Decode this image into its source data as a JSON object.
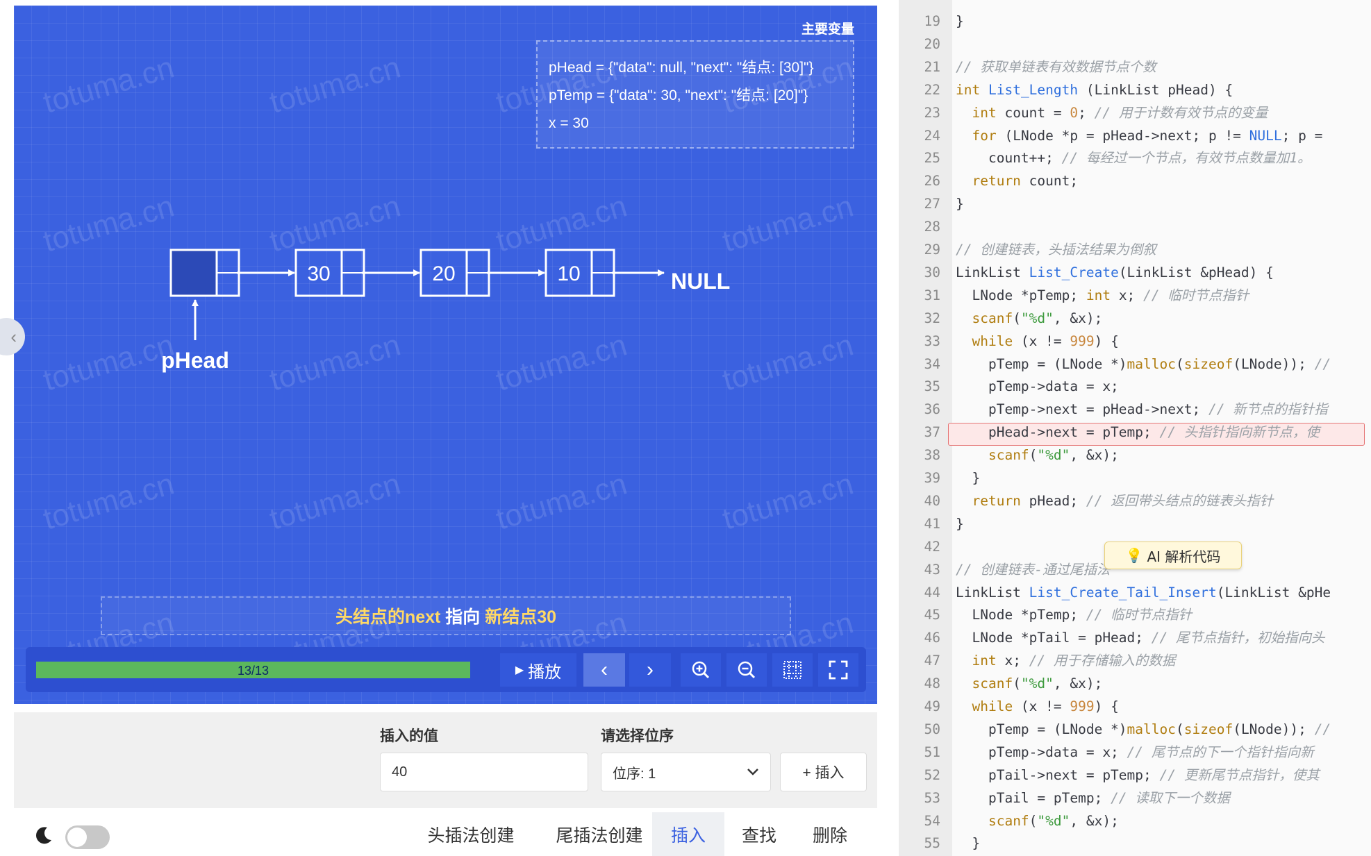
{
  "visual": {
    "vars_title": "主要变量",
    "vars": [
      "pHead = {\"data\": null, \"next\": \"结点: [30]\"}",
      "pTemp = {\"data\": 30, \"next\": \"结点: [20]\"}",
      "x = 30"
    ],
    "watermark": "totuma.cn",
    "nodes": [
      "",
      "30",
      "20",
      "10"
    ],
    "null_label": "NULL",
    "head_label": "pHead",
    "caption": {
      "part1": "头结点的next",
      "part2": " 指向 ",
      "part3": "新结点30"
    }
  },
  "controls": {
    "progress_text": "13/13",
    "progress": 1.0,
    "play_label": "播放",
    "prev_glyph": "‹",
    "next_glyph": "›"
  },
  "form": {
    "value_label": "插入的值",
    "value": "40",
    "position_label": "请选择位序",
    "position_value": "位序: 1",
    "insert_label": "+ 插入"
  },
  "tabs": [
    {
      "label": "头插法创建",
      "active": false
    },
    {
      "label": "尾插法创建",
      "active": false
    },
    {
      "label": "插入",
      "active": true
    },
    {
      "label": "查找",
      "active": false
    },
    {
      "label": "删除",
      "active": false
    }
  ],
  "ai_button": "AI 解析代码",
  "code": {
    "highlight_line": 37,
    "lines": [
      {
        "n": "19",
        "t": [
          [
            "p",
            "}"
          ]
        ]
      },
      {
        "n": "20",
        "t": []
      },
      {
        "n": "21",
        "t": [
          [
            "cm",
            "// 获取单链表有效数据节点个数"
          ]
        ]
      },
      {
        "n": "22",
        "t": [
          [
            "kw",
            "int"
          ],
          [
            "p",
            " "
          ],
          [
            "fn",
            "List_Length"
          ],
          [
            "p",
            " (LinkList pHead) {"
          ]
        ]
      },
      {
        "n": "23",
        "t": [
          [
            "p",
            "  "
          ],
          [
            "kw",
            "int"
          ],
          [
            "p",
            " count = "
          ],
          [
            "num",
            "0"
          ],
          [
            "p",
            "; "
          ],
          [
            "cm",
            "// 用于计数有效节点的变量"
          ]
        ]
      },
      {
        "n": "24",
        "t": [
          [
            "p",
            "  "
          ],
          [
            "kw",
            "for"
          ],
          [
            "p",
            " (LNode *p = pHead->next; p != "
          ],
          [
            "nul",
            "NULL"
          ],
          [
            "p",
            "; p ="
          ]
        ]
      },
      {
        "n": "25",
        "t": [
          [
            "p",
            "    count++; "
          ],
          [
            "cm",
            "// 每经过一个节点，有效节点数量加1。"
          ]
        ]
      },
      {
        "n": "26",
        "t": [
          [
            "p",
            "  "
          ],
          [
            "kw",
            "return"
          ],
          [
            "p",
            " count;"
          ]
        ]
      },
      {
        "n": "27",
        "t": [
          [
            "p",
            "}"
          ]
        ]
      },
      {
        "n": "28",
        "t": []
      },
      {
        "n": "29",
        "t": [
          [
            "cm",
            "// 创建链表，头插法结果为倒叙"
          ]
        ]
      },
      {
        "n": "30",
        "t": [
          [
            "p",
            "LinkList "
          ],
          [
            "fn",
            "List_Create"
          ],
          [
            "p",
            "(LinkList &pHead) {"
          ]
        ]
      },
      {
        "n": "31",
        "t": [
          [
            "p",
            "  LNode *pTemp; "
          ],
          [
            "kw",
            "int"
          ],
          [
            "p",
            " x; "
          ],
          [
            "cm",
            "// 临时节点指针"
          ]
        ]
      },
      {
        "n": "32",
        "t": [
          [
            "p",
            "  "
          ],
          [
            "kw",
            "scanf"
          ],
          [
            "p",
            "("
          ],
          [
            "str",
            "\"%d\""
          ],
          [
            "p",
            ", &x);"
          ]
        ]
      },
      {
        "n": "33",
        "t": [
          [
            "p",
            "  "
          ],
          [
            "kw",
            "while"
          ],
          [
            "p",
            " (x != "
          ],
          [
            "num",
            "999"
          ],
          [
            "p",
            ") {"
          ]
        ]
      },
      {
        "n": "34",
        "t": [
          [
            "p",
            "    pTemp = (LNode *)"
          ],
          [
            "kw",
            "malloc"
          ],
          [
            "p",
            "("
          ],
          [
            "kw",
            "sizeof"
          ],
          [
            "p",
            "(LNode)); "
          ],
          [
            "cm",
            "//"
          ]
        ]
      },
      {
        "n": "35",
        "t": [
          [
            "p",
            "    pTemp->data = x;"
          ]
        ]
      },
      {
        "n": "36",
        "t": [
          [
            "p",
            "    pTemp->next = pHead->next; "
          ],
          [
            "cm",
            "// 新节点的指针指"
          ]
        ]
      },
      {
        "n": "37",
        "t": [
          [
            "p",
            "    pHead->next = pTemp; "
          ],
          [
            "cm",
            "// 头指针指向新节点，使"
          ]
        ]
      },
      {
        "n": "38",
        "t": [
          [
            "p",
            "    "
          ],
          [
            "kw",
            "scanf"
          ],
          [
            "p",
            "("
          ],
          [
            "str",
            "\"%d\""
          ],
          [
            "p",
            ", &x);"
          ]
        ]
      },
      {
        "n": "39",
        "t": [
          [
            "p",
            "  }"
          ]
        ]
      },
      {
        "n": "40",
        "t": [
          [
            "p",
            "  "
          ],
          [
            "kw",
            "return"
          ],
          [
            "p",
            " pHead; "
          ],
          [
            "cm",
            "// 返回带头结点的链表头指针"
          ]
        ]
      },
      {
        "n": "41",
        "t": [
          [
            "p",
            "}"
          ]
        ]
      },
      {
        "n": "42",
        "t": []
      },
      {
        "n": "43",
        "t": [
          [
            "cm",
            "// 创建链表-通过尾插法"
          ]
        ]
      },
      {
        "n": "44",
        "t": [
          [
            "p",
            "LinkList "
          ],
          [
            "fn",
            "List_Create_Tail_Insert"
          ],
          [
            "p",
            "(LinkList &pHe"
          ]
        ]
      },
      {
        "n": "45",
        "t": [
          [
            "p",
            "  LNode *pTemp; "
          ],
          [
            "cm",
            "// 临时节点指针"
          ]
        ]
      },
      {
        "n": "46",
        "t": [
          [
            "p",
            "  LNode *pTail = pHead; "
          ],
          [
            "cm",
            "// 尾节点指针，初始指向头"
          ]
        ]
      },
      {
        "n": "47",
        "t": [
          [
            "p",
            "  "
          ],
          [
            "kw",
            "int"
          ],
          [
            "p",
            " x; "
          ],
          [
            "cm",
            "// 用于存储输入的数据"
          ]
        ]
      },
      {
        "n": "48",
        "t": [
          [
            "p",
            "  "
          ],
          [
            "kw",
            "scanf"
          ],
          [
            "p",
            "("
          ],
          [
            "str",
            "\"%d\""
          ],
          [
            "p",
            ", &x);"
          ]
        ]
      },
      {
        "n": "49",
        "t": [
          [
            "p",
            "  "
          ],
          [
            "kw",
            "while"
          ],
          [
            "p",
            " (x != "
          ],
          [
            "num",
            "999"
          ],
          [
            "p",
            ") {"
          ]
        ]
      },
      {
        "n": "50",
        "t": [
          [
            "p",
            "    pTemp = (LNode *)"
          ],
          [
            "kw",
            "malloc"
          ],
          [
            "p",
            "("
          ],
          [
            "kw",
            "sizeof"
          ],
          [
            "p",
            "(LNode)); "
          ],
          [
            "cm",
            "//"
          ]
        ]
      },
      {
        "n": "51",
        "t": [
          [
            "p",
            "    pTemp->data = x; "
          ],
          [
            "cm",
            "// 尾节点的下一个指针指向新"
          ]
        ]
      },
      {
        "n": "52",
        "t": [
          [
            "p",
            "    pTail->next = pTemp; "
          ],
          [
            "cm",
            "// 更新尾节点指针，使其"
          ]
        ]
      },
      {
        "n": "53",
        "t": [
          [
            "p",
            "    pTail = pTemp; "
          ],
          [
            "cm",
            "// 读取下一个数据"
          ]
        ]
      },
      {
        "n": "54",
        "t": [
          [
            "p",
            "    "
          ],
          [
            "kw",
            "scanf"
          ],
          [
            "p",
            "("
          ],
          [
            "str",
            "\"%d\""
          ],
          [
            "p",
            ", &x);"
          ]
        ]
      },
      {
        "n": "55",
        "t": [
          [
            "p",
            "  }"
          ]
        ]
      }
    ]
  }
}
